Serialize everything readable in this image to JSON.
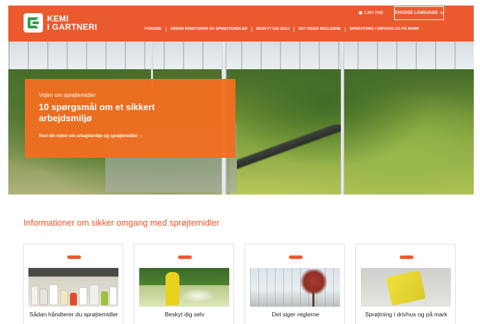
{
  "brand": {
    "line1": "KEMI",
    "line2": "I GARTNERI"
  },
  "header": {
    "read_aloud": "Læs højt",
    "language_button": "CHOOSE LANGUAGE",
    "nav": [
      "FORSIDE",
      "SÅDAN HÅNDTERER DU SPRØJTEMIDLER",
      "BESKYT DIG SELV",
      "DET SIGER REGLERNE",
      "SPRØJTNING I DRIVHUS OG PÅ MARK"
    ]
  },
  "hero": {
    "kicker": "Viden om sprøjtemidler",
    "title": "10 spørgsmål om et sikkert arbejdsmiljø",
    "link": "Test din viden om arbejdsmiljø og sprøjtemidler"
  },
  "section": {
    "title": "Informationer om sikker omgang med sprøjtemidler",
    "cards": [
      {
        "label": "Sådan håndterer du sprøjtemidler"
      },
      {
        "label": "Beskyt dig selv"
      },
      {
        "label": "Det siger reglerne"
      },
      {
        "label": "Sprøjtning i drivhus og på mark"
      }
    ]
  },
  "colors": {
    "accent": "#ea5a2e",
    "logo_green": "#2e9e48",
    "promo": "#f06e20"
  },
  "icons": [
    "logo-mark-icon",
    "speaker-icon",
    "plus-icon",
    "chevron-right-icon"
  ]
}
